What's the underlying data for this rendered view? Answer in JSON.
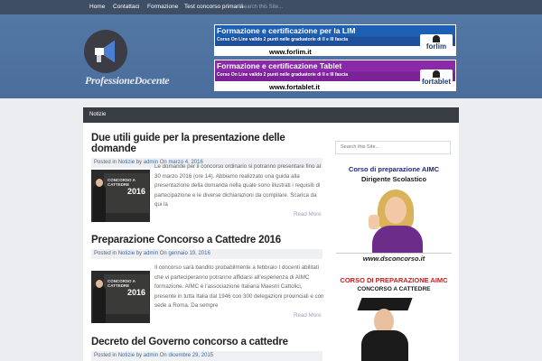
{
  "topnav": {
    "items": [
      "Home",
      "Contattaci",
      "Formazione",
      "Test concorso primaria"
    ],
    "search_placeholder": "Search this Site..."
  },
  "header": {
    "logo_text": "ProfessioneDocente",
    "banners": [
      {
        "title": "Formazione e certificazione per la LIM",
        "subtitle": "Corso On Line valido 2 punti nelle graduatorie di II e III fascia",
        "url": "www.forlim.it",
        "logo": "forlim"
      },
      {
        "title": "Formazione e certificazione Tablet",
        "subtitle": "Corso On Line valido 2 punti nelle graduatorie di II e III fascia",
        "url": "www.fortablet.it",
        "logo": "fortablet"
      }
    ]
  },
  "subnav": {
    "items": [
      "Notizie"
    ]
  },
  "posts": [
    {
      "title": "Due utili guide per la presentazione delle domande",
      "meta_prefix": "Posted in",
      "category": "Notizie",
      "by": "by",
      "author": "admin",
      "on": "On",
      "date": "marzo 4, 2016",
      "thumb_text": "CONCORSO A CATTEDRE",
      "thumb_year": "2016",
      "excerpt": "Le domande per il concorso ordinario si potranno presentare fino al 30 marzo 2016 (ore 14). Abbiamo realizzato una guida alla presentazione della domanda nella quale sono illustrati i requisiti di partecipazione e le diverse dichiarazioni da compilare. Scarica da qui la",
      "read_more": "Read More"
    },
    {
      "title": "Preparazione Concorso a Cattedre 2016",
      "meta_prefix": "Posted in",
      "category": "Notizie",
      "by": "by",
      "author": "admin",
      "on": "On",
      "date": "gennaio 19, 2016",
      "thumb_text": "CONCORSO A CATTEDRE",
      "thumb_year": "2016",
      "excerpt": "Il concorso sarà bandito probabilmente a febbraio I docenti abilitati che vi parteciperanno potranno affidarsi all'esperienza di AIMC formazione. AIMC è l'associazione Italiana Maestri Cattolici, presente in tutta Italia dal 1946 con 300 delegazioni provinciali e con sede a Roma. Da sempre",
      "read_more": "Read More"
    },
    {
      "title": "Decreto del Governo concorso a cattedre",
      "meta_prefix": "Posted in",
      "category": "Notizie",
      "by": "by",
      "author": "admin",
      "on": "On",
      "date": "dicembre 29, 2015"
    }
  ],
  "sidebar": {
    "search_placeholder": "Search this Site...",
    "ad1": {
      "title": "Corso di preparazione AIMC",
      "subtitle": "Dirigente Scolastico",
      "url": "www.dsconcorso.it"
    },
    "ad2": {
      "title": "CORSO DI PREPARAZIONE AIMC",
      "subtitle": "CONCORSO A CATTEDRE"
    }
  },
  "colors": {
    "topnav_bg": "#3e4e64",
    "header_bg": "#5074a2",
    "subnav_bg": "#383d44",
    "link": "#3a6aa2"
  }
}
